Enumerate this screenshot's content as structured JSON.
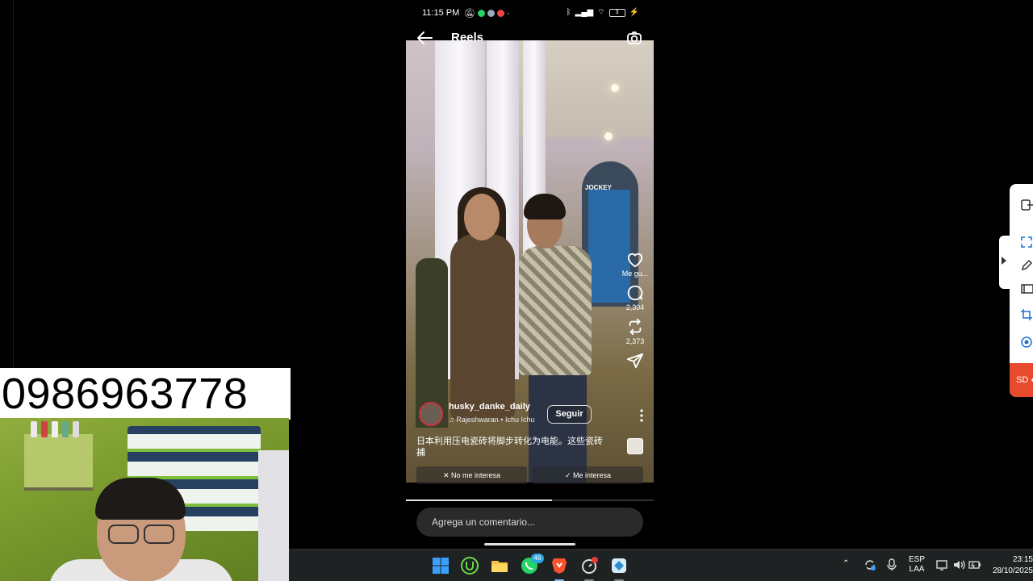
{
  "phone_number": "0986963778",
  "status_bar": {
    "time": "11:15 PM",
    "battery": "3"
  },
  "reels": {
    "title": "Reels",
    "video_sign": "JOCKEY",
    "actions": [
      {
        "icon": "heart-icon",
        "label": "Me gu..."
      },
      {
        "icon": "comment-icon",
        "label": "2,304"
      },
      {
        "icon": "repost-icon",
        "label": "2,373"
      },
      {
        "icon": "share-icon",
        "label": ""
      }
    ],
    "username": "husky_danke_daily",
    "music": "Rajeshwaran • Ichu Ichu",
    "follow_label": "Seguir",
    "caption": "日本利用压电瓷砖将脚步转化为电能。这些瓷砖捕",
    "caption_more": "...",
    "not_interested": "No me interesa",
    "interested": "Me interesa",
    "comment_placeholder": "Agrega un comentario...",
    "progress": 0.59
  },
  "snipping_panel": {
    "label": "SD"
  },
  "taskbar": {
    "whatsapp_badge": "46",
    "language": "ESP",
    "layout": "LAA",
    "clock_time": "23:15",
    "clock_date": "28/10/2025"
  },
  "colors": {
    "accent_red": "#e84a2c",
    "taskbar_bg": "#1f2222",
    "windows_blue": "#1e90ff"
  }
}
